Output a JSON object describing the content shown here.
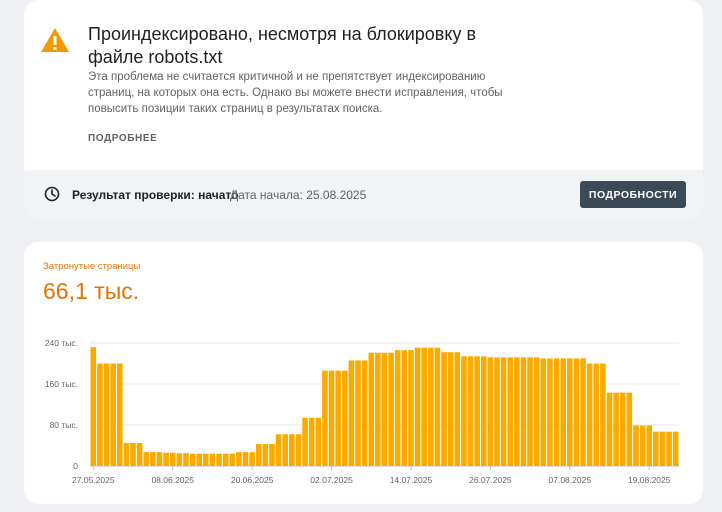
{
  "issue": {
    "title": "Проиндексировано, несмотря на блокировку в файле robots.txt",
    "description": "Эта проблема не считается критичной и не препятствует индексированию страниц, на которых она есть. Однако вы можете внести исправления, чтобы повысить позиции таких страниц в результатах поиска.",
    "more_link": "ПОДРОБНЕЕ",
    "icon": "warning-icon",
    "icon_color": "#f29900"
  },
  "status": {
    "label": "Результат проверки: начато",
    "date": "Дата начала: 25.08.2025",
    "button": "ПОДРОБНОСТИ",
    "icon": "clock-icon"
  },
  "metric": {
    "label": "Затронутые страницы",
    "value": "66,1 тыс.",
    "color": "#e37400"
  },
  "chart_data": {
    "type": "bar",
    "bar_color": "#f9ab00",
    "ylim": [
      0,
      240000
    ],
    "y_ticks": [
      {
        "value": 0,
        "label": "0"
      },
      {
        "value": 80000,
        "label": "80 тыс."
      },
      {
        "value": 160000,
        "label": "160 тыс."
      },
      {
        "value": 240000,
        "label": "240 тыс."
      }
    ],
    "x_ticks": [
      {
        "index": 0,
        "label": "27.05.2025"
      },
      {
        "index": 12,
        "label": "08.06.2025"
      },
      {
        "index": 24,
        "label": "20.06.2025"
      },
      {
        "index": 36,
        "label": "02.07.2025"
      },
      {
        "index": 48,
        "label": "14.07.2025"
      },
      {
        "index": 60,
        "label": "26.07.2025"
      },
      {
        "index": 72,
        "label": "07.08.2025"
      },
      {
        "index": 84,
        "label": "19.08.2025"
      }
    ],
    "start_date": "27.05.2025",
    "values": [
      232000,
      200000,
      200000,
      200000,
      200000,
      45000,
      45000,
      45000,
      27000,
      27000,
      27000,
      26000,
      26000,
      25000,
      25000,
      24000,
      24000,
      24000,
      24000,
      24000,
      24000,
      24000,
      27000,
      27000,
      27000,
      43000,
      43000,
      43000,
      62000,
      62000,
      62000,
      62000,
      94000,
      94000,
      94000,
      186000,
      186000,
      186000,
      186000,
      206000,
      206000,
      206000,
      221000,
      221000,
      221000,
      221000,
      226000,
      226000,
      226000,
      231000,
      231000,
      231000,
      231000,
      222000,
      222000,
      222000,
      214000,
      214000,
      214000,
      214000,
      212000,
      212000,
      212000,
      212000,
      212000,
      212000,
      212000,
      212000,
      210000,
      210000,
      210000,
      210000,
      210000,
      210000,
      210000,
      200000,
      200000,
      200000,
      143000,
      143000,
      143000,
      143000,
      79000,
      79000,
      79000,
      67000,
      67000,
      67000,
      67000
    ]
  }
}
